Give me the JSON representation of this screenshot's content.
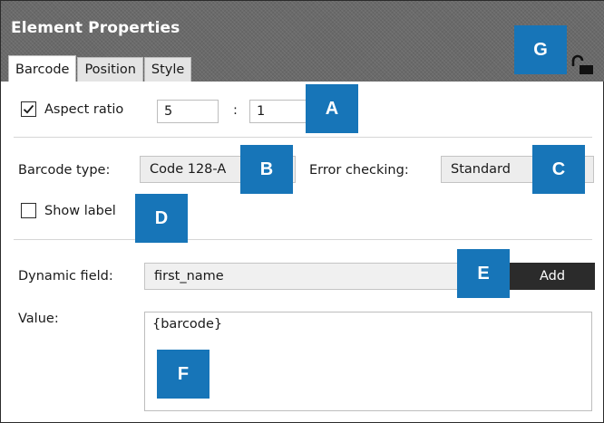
{
  "window": {
    "title": "Element Properties"
  },
  "tabs": [
    {
      "label": "Barcode",
      "active": true
    },
    {
      "label": "Position",
      "active": false
    },
    {
      "label": "Style",
      "active": false
    }
  ],
  "aspect_ratio": {
    "label": "Aspect ratio",
    "checked": true,
    "left_value": "5",
    "separator": ":",
    "right_value": "1"
  },
  "barcode_type": {
    "label": "Barcode type:",
    "value": "Code 128-A"
  },
  "error_checking": {
    "label": "Error checking:",
    "value": "Standard"
  },
  "show_label": {
    "label": "Show label",
    "checked": false
  },
  "dynamic_field": {
    "label": "Dynamic field:",
    "value": "first_name",
    "add_label": "Add"
  },
  "value_field": {
    "label": "Value:",
    "value": "{barcode}"
  },
  "callouts": {
    "a": "A",
    "b": "B",
    "c": "C",
    "d": "D",
    "e": "E",
    "f": "F",
    "g": "G"
  },
  "icons": {
    "lock": "unlocked-padlock-icon",
    "check": "checkmark-icon"
  },
  "colors": {
    "header_bg": "#6a6a6a",
    "callout_bg": "#1775b8",
    "add_button_bg": "#2b2b2b"
  }
}
